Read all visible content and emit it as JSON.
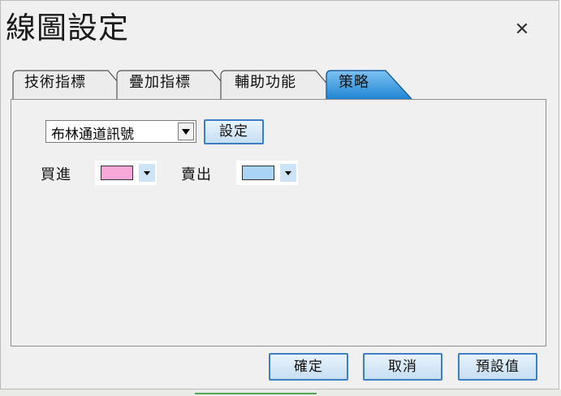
{
  "window": {
    "title": "線圖設定",
    "close_glyph": "✕"
  },
  "tabs": [
    {
      "label": "技術指標",
      "selected": false
    },
    {
      "label": "疊加指標",
      "selected": false
    },
    {
      "label": "輔助功能",
      "selected": false
    },
    {
      "label": "策略",
      "selected": true
    }
  ],
  "strategy": {
    "selected_strategy": "布林通道訊號",
    "settings_button": "設定",
    "buy_label": "買進",
    "buy_color": "#f7a8d8",
    "sell_label": "賣出",
    "sell_color": "#a9d4f5"
  },
  "footer": {
    "ok_button": "確定",
    "cancel_button": "取消",
    "default_button": "預設值"
  },
  "colors": {
    "accent_border": "#3d7fc0",
    "selected_tab_fill": "#2f8fd8"
  }
}
